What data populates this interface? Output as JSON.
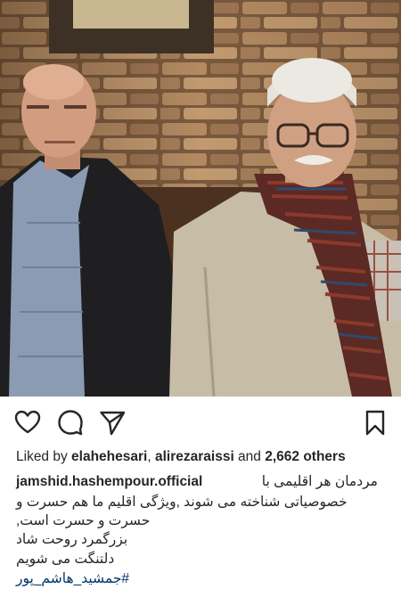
{
  "post": {
    "image_alt": "",
    "actions": {
      "like_icon": "heart-icon",
      "comment_icon": "comment-icon",
      "share_icon": "paper-plane-icon",
      "save_icon": "bookmark-icon"
    },
    "likes": {
      "prefix": "Liked by ",
      "user1": "elahehesari",
      "separator": ", ",
      "user2": "alirezaraissi",
      "and": " and ",
      "others": "2,662 others"
    },
    "caption": {
      "username": "jamshid.hashempour.official",
      "line1": "مردمان هر اقلیمی با",
      "line2": "خصوصیاتی شناخته می شوند ,ویژگی اقلیم ما هم حسرت و",
      "line3": "حسرت و حسرت است,",
      "line4": "بزرگمرد روحت شاد",
      "line5": "دلتنگت می شویم",
      "hashtag": "#جمشید_هاشم_پور"
    },
    "colors": {
      "text": "#262626",
      "hashtag": "#003569"
    }
  }
}
